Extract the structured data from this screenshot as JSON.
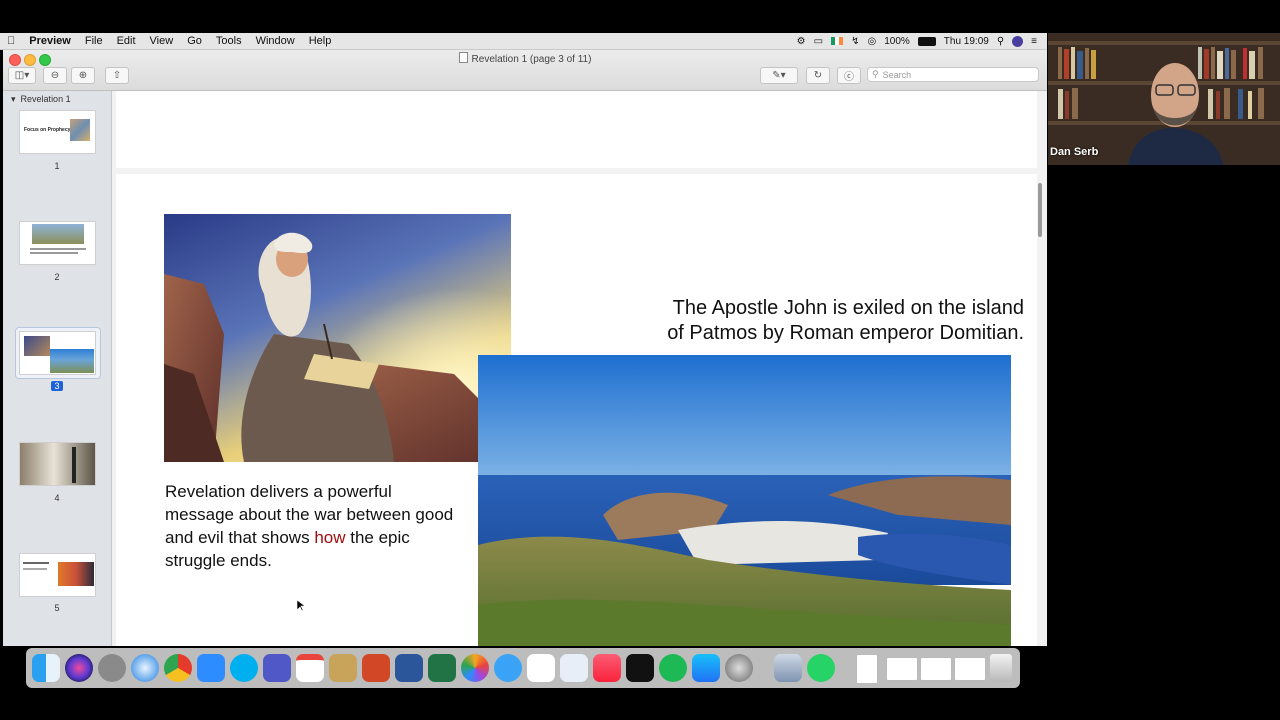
{
  "menubar": {
    "apple": "",
    "app_name": "Preview",
    "items": [
      "File",
      "Edit",
      "View",
      "Go",
      "Tools",
      "Window",
      "Help"
    ],
    "battery": "100%",
    "clock": "Thu 19:09"
  },
  "window": {
    "title": "Revelation 1 (page 3 of 11)",
    "search_placeholder": "Search"
  },
  "sidebar": {
    "doc_name": "Revelation 1",
    "thumbs": [
      {
        "num": "1",
        "caption": "Focus on Prophecy"
      },
      {
        "num": "2"
      },
      {
        "num": "3"
      },
      {
        "num": "4"
      },
      {
        "num": "5"
      }
    ]
  },
  "page3": {
    "title_line1": "The Apostle John is exiled on the island",
    "title_line2": "of Patmos by Roman emperor Domitian.",
    "body_before": "Revelation delivers a powerful message about the war between good and evil that shows ",
    "body_highlight": "how",
    "body_after": " the epic struggle ends."
  },
  "webcam": {
    "participant": "Dan Serb"
  },
  "colors": {
    "highlight_red": "#a30d0d",
    "selection_blue": "#1d62d8"
  },
  "dock_icons": [
    "finder-icon",
    "siri-icon",
    "launchpad-icon",
    "safari-icon",
    "chrome-icon",
    "zoom-icon",
    "skype-icon",
    "teams-icon",
    "calendar-icon",
    "notes-icon",
    "powerpoint-icon",
    "word-icon",
    "excel-icon",
    "photos-icon",
    "messages-icon",
    "numbers-icon",
    "keynote-icon",
    "music-icon",
    "tv-icon",
    "spotify-icon",
    "appstore-icon",
    "settings-icon",
    "preview-icon",
    "whatsapp-icon",
    "document-icon",
    "trash-icon"
  ]
}
